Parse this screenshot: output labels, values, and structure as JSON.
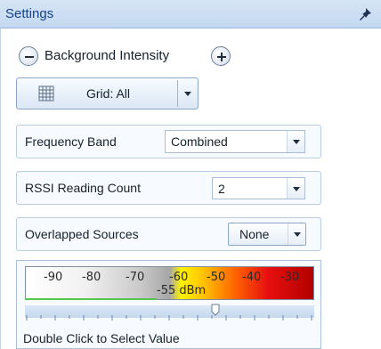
{
  "panel": {
    "title": "Settings"
  },
  "background_intensity": {
    "label": "Background Intensity"
  },
  "grid_button": {
    "label": "Grid: All"
  },
  "frequency_band": {
    "label": "Frequency Band",
    "value": "Combined"
  },
  "rssi_reading_count": {
    "label": "RSSI Reading Count",
    "value": "2"
  },
  "overlapped_sources": {
    "label": "Overlapped Sources",
    "value": "None"
  },
  "intensity_slider": {
    "scale": [
      "-90",
      "-80",
      "-70",
      "-60",
      "-50",
      "-40",
      "-30"
    ],
    "value_text": "-55 dBm",
    "hint": "Double Click to Select Value"
  },
  "colors": {
    "titlebar": "#c3d8f0",
    "title_text": "#15428b",
    "accent_border": "#b8cce4"
  },
  "icons": [
    "pin-icon",
    "minus-icon",
    "plus-icon",
    "grid-icon",
    "chevron-down-icon",
    "slider-thumb-icon"
  ]
}
